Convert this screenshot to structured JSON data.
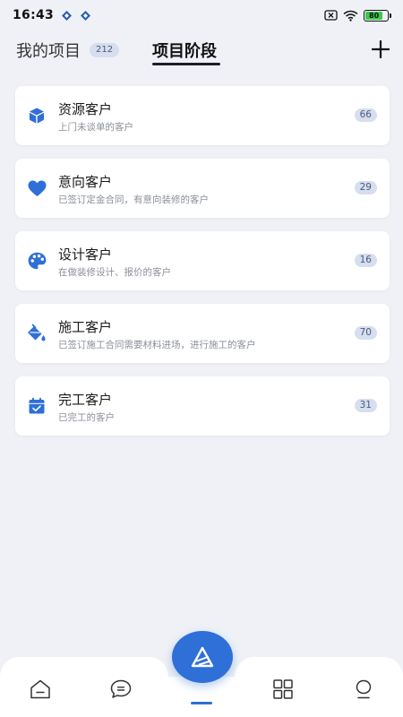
{
  "status_bar": {
    "time": "16:43",
    "battery_level": "80"
  },
  "header": {
    "tab_projects_label": "我的项目",
    "tab_projects_count": "212",
    "tab_stage_label": "项目阶段"
  },
  "stages": [
    {
      "title": "资源客户",
      "subtitle": "上门未谈单的客户",
      "count": "66",
      "icon": "cube-icon"
    },
    {
      "title": "意向客户",
      "subtitle": "已签订定金合同，有意向装修的客户",
      "count": "29",
      "icon": "heart-icon"
    },
    {
      "title": "设计客户",
      "subtitle": "在做装修设计、报价的客户",
      "count": "16",
      "icon": "palette-icon"
    },
    {
      "title": "施工客户",
      "subtitle": "已签订施工合同需要材料进场，进行施工的客户",
      "count": "70",
      "icon": "paint-bucket-icon"
    },
    {
      "title": "完工客户",
      "subtitle": "已完工的客户",
      "count": "31",
      "icon": "calendar-check-icon"
    }
  ],
  "colors": {
    "accent": "#2f6fd8",
    "background": "#eff1f6",
    "pill_bg": "#d6deef"
  },
  "bottom_nav": {
    "items": [
      "home-icon",
      "chat-icon",
      "compose-icon",
      "grid-icon",
      "profile-icon"
    ]
  }
}
